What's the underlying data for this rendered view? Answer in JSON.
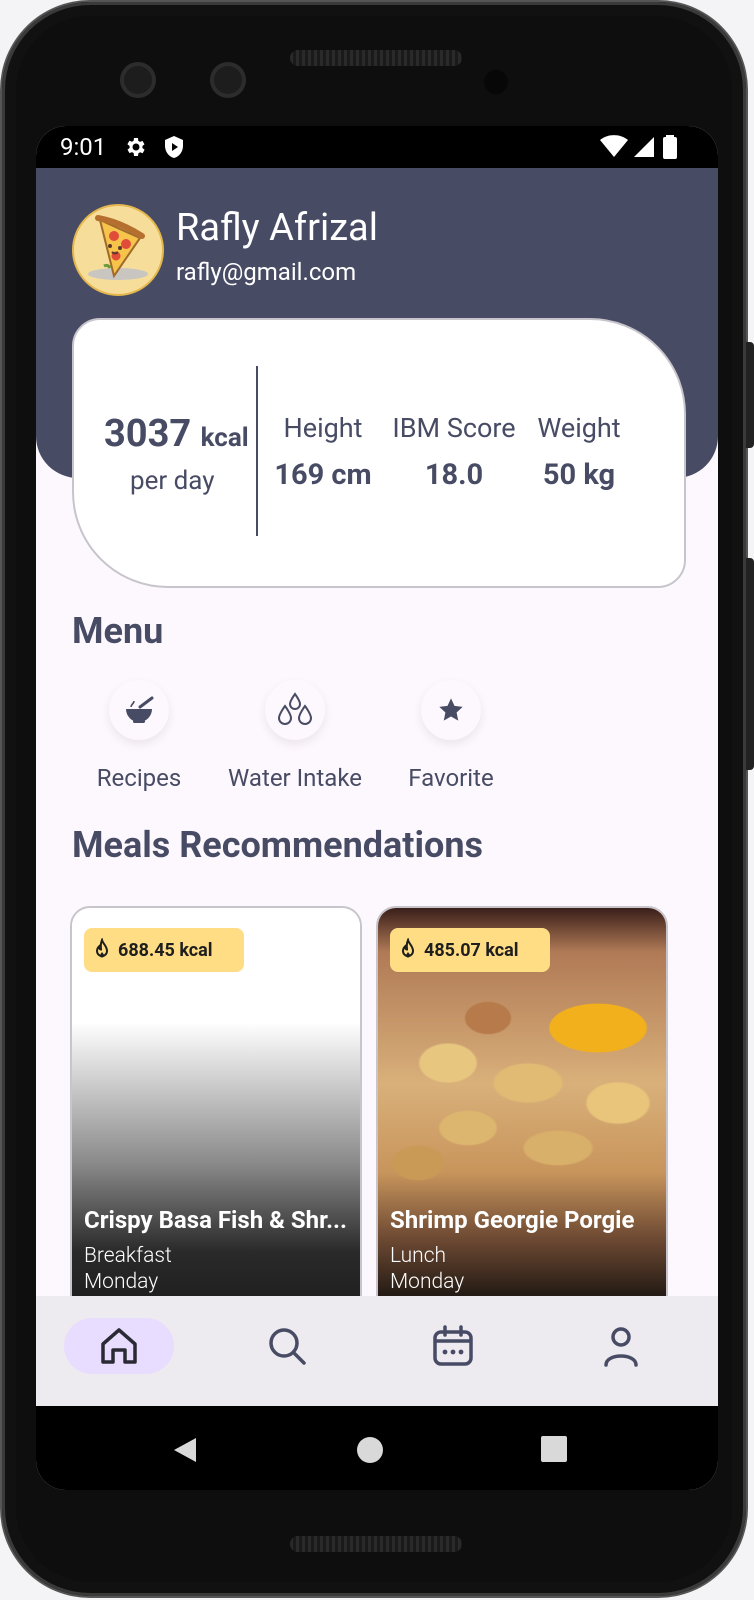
{
  "status_bar": {
    "time": "9:01",
    "icons": [
      "gear-icon",
      "shield-play-icon",
      "wifi-icon",
      "signal-icon",
      "battery-icon"
    ]
  },
  "profile": {
    "name": "Rafly Afrizal",
    "email": "rafly@gmail.com",
    "avatar": "pizza-avatar"
  },
  "stats": {
    "kcal_value": "3037",
    "kcal_unit": "kcal",
    "kcal_per": "per day",
    "items": [
      {
        "label": "Height",
        "value": "169 cm"
      },
      {
        "label": "IBM Score",
        "value": "18.0"
      },
      {
        "label": "Weight",
        "value": "50 kg"
      }
    ]
  },
  "menu": {
    "title": "Menu",
    "items": [
      {
        "label": "Recipes",
        "icon": "bowl-icon"
      },
      {
        "label": "Water Intake",
        "icon": "water-drops-icon"
      },
      {
        "label": "Favorite",
        "icon": "star-icon"
      }
    ]
  },
  "meals": {
    "title": "Meals Recommendations",
    "items": [
      {
        "kcal": "688.45 kcal",
        "title": "Crispy Basa Fish & Shr...",
        "type": "Breakfast",
        "day": "Monday"
      },
      {
        "kcal": "485.07 kcal",
        "title": "Shrimp Georgie Porgie",
        "type": "Lunch",
        "day": "Monday"
      }
    ]
  },
  "bottom_nav": {
    "items": [
      "home-icon",
      "search-icon",
      "calendar-icon",
      "profile-icon"
    ],
    "active": "home-icon"
  },
  "colors": {
    "primary": "#474b64",
    "badge": "#ffdd85",
    "nav_active": "#e9ddff",
    "background": "#fdf8fd"
  }
}
